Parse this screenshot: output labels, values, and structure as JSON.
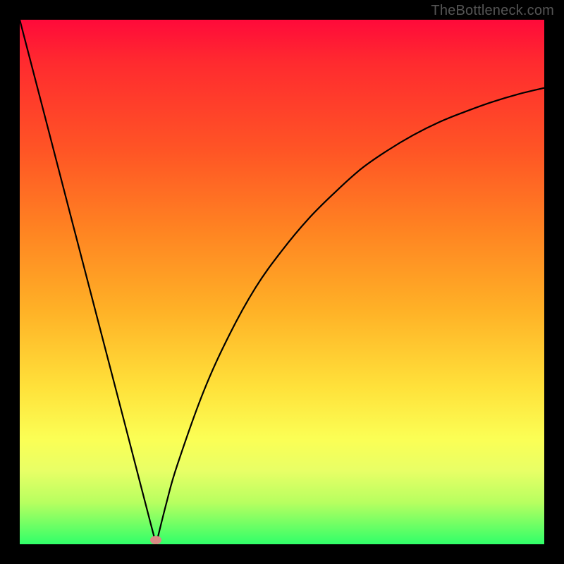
{
  "watermark": "TheBottleneck.com",
  "chart_data": {
    "type": "line",
    "title": "",
    "xlabel": "",
    "ylabel": "",
    "xlim": [
      0,
      100
    ],
    "ylim": [
      0,
      100
    ],
    "background_gradient": {
      "top": "#ff0a3a",
      "bottom": "#30ff69"
    },
    "series": [
      {
        "name": "left-branch",
        "x": [
          0,
          5,
          10,
          15,
          20,
          23,
          25,
          26
        ],
        "values": [
          100,
          80.8,
          61.5,
          42.3,
          23.1,
          11.5,
          3.8,
          0
        ]
      },
      {
        "name": "right-branch",
        "x": [
          26,
          28,
          30,
          35,
          40,
          45,
          50,
          55,
          60,
          65,
          70,
          75,
          80,
          85,
          90,
          95,
          100
        ],
        "values": [
          0,
          8,
          15,
          29,
          40,
          49,
          56,
          62,
          67,
          71.5,
          75,
          78,
          80.5,
          82.5,
          84.3,
          85.8,
          87
        ]
      }
    ],
    "marker": {
      "x": 26,
      "y": 0.8,
      "color": "#d98a84"
    },
    "grid": false,
    "legend": false
  }
}
